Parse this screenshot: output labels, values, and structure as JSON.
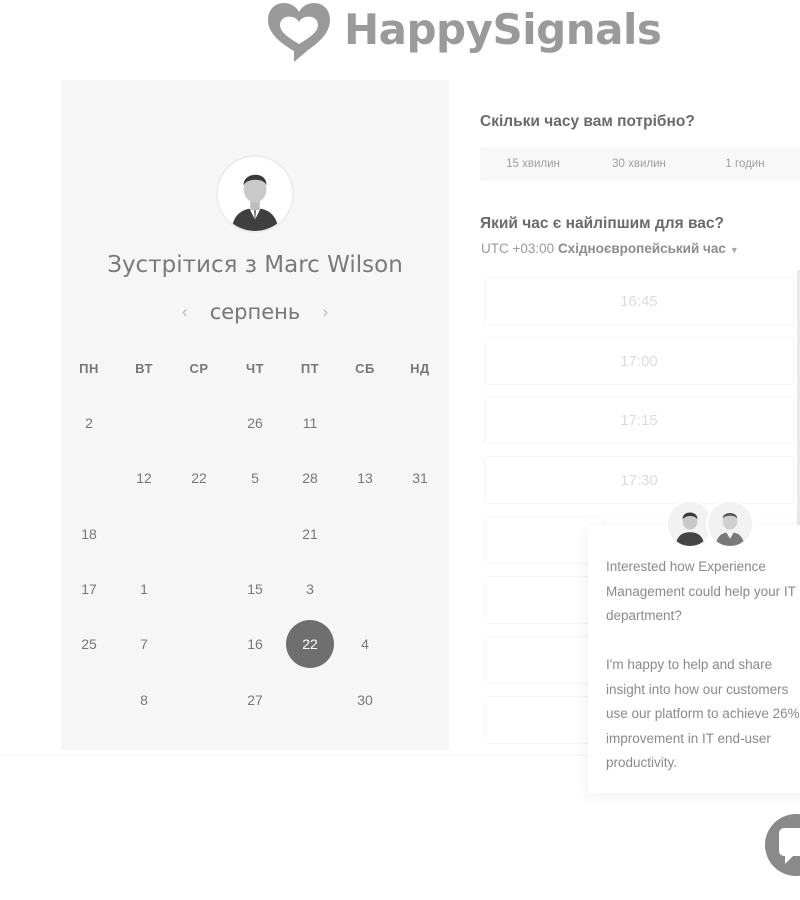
{
  "header": {
    "brand": "HappySignals"
  },
  "calendar": {
    "title": "Зустрітися з Marc Wilson",
    "month": "серпень",
    "weekdays": [
      "ПН",
      "ВТ",
      "СР",
      "ЧТ",
      "ПТ",
      "СБ",
      "НД"
    ],
    "weeks": [
      [
        {
          "d": "2",
          "s": "active"
        },
        {
          "d": "",
          "s": "inactive"
        },
        {
          "d": "",
          "s": "inactive"
        },
        {
          "d": "26",
          "s": "active"
        },
        {
          "d": "11",
          "s": "active"
        },
        {
          "d": "",
          "s": "inactive"
        },
        {
          "d": "",
          "s": "inactive"
        }
      ],
      [
        {
          "d": "",
          "s": "inactive"
        },
        {
          "d": "12",
          "s": "active"
        },
        {
          "d": "22",
          "s": "active"
        },
        {
          "d": "5",
          "s": "active"
        },
        {
          "d": "28",
          "s": "active"
        },
        {
          "d": "13",
          "s": "active"
        },
        {
          "d": "31",
          "s": "active"
        }
      ],
      [
        {
          "d": "18",
          "s": "active"
        },
        {
          "d": "",
          "s": "inactive"
        },
        {
          "d": "",
          "s": "inactive"
        },
        {
          "d": "",
          "s": "inactive"
        },
        {
          "d": "21",
          "s": "active"
        },
        {
          "d": "",
          "s": "inactive"
        },
        {
          "d": "",
          "s": "inactive"
        }
      ],
      [
        {
          "d": "17",
          "s": "active"
        },
        {
          "d": "1",
          "s": "active"
        },
        {
          "d": "",
          "s": "inactive"
        },
        {
          "d": "15",
          "s": "active"
        },
        {
          "d": "3",
          "s": "active"
        },
        {
          "d": "",
          "s": "inactive"
        },
        {
          "d": "",
          "s": "inactive"
        }
      ],
      [
        {
          "d": "25",
          "s": "active"
        },
        {
          "d": "7",
          "s": "active"
        },
        {
          "d": "",
          "s": "inactive"
        },
        {
          "d": "16",
          "s": "active"
        },
        {
          "d": "22",
          "s": "selected"
        },
        {
          "d": "4",
          "s": "active"
        },
        {
          "d": "",
          "s": "inactive"
        }
      ],
      [
        {
          "d": "",
          "s": "inactive"
        },
        {
          "d": "8",
          "s": "active"
        },
        {
          "d": "",
          "s": "inactive"
        },
        {
          "d": "27",
          "s": "active"
        },
        {
          "d": "",
          "s": "inactive"
        },
        {
          "d": "30",
          "s": "active"
        },
        {
          "d": "",
          "s": "inactive"
        }
      ]
    ]
  },
  "duration": {
    "question": "Скільки часу вам потрібно?",
    "options": [
      "15 хвилин",
      "30 хвилин",
      "1 годин"
    ]
  },
  "time": {
    "question": "Який час є найліпшим для вас?",
    "tz_offset": "UTC +03:00",
    "tz_name": "Східноєвропейський час",
    "slots": [
      "16:45",
      "17:00",
      "17:15",
      "17:30"
    ]
  },
  "chat": {
    "paragraph1": "Interested how Experience Management could help your IT department?",
    "paragraph2": "I'm happy to help and share insight into how our customers use our platform to achieve 26% improvement in IT end-user productivity."
  },
  "colors": {
    "selected_day": "#6f6f6f",
    "panel_bg": "#f6f6f6",
    "logo": "#9a9a9a"
  }
}
